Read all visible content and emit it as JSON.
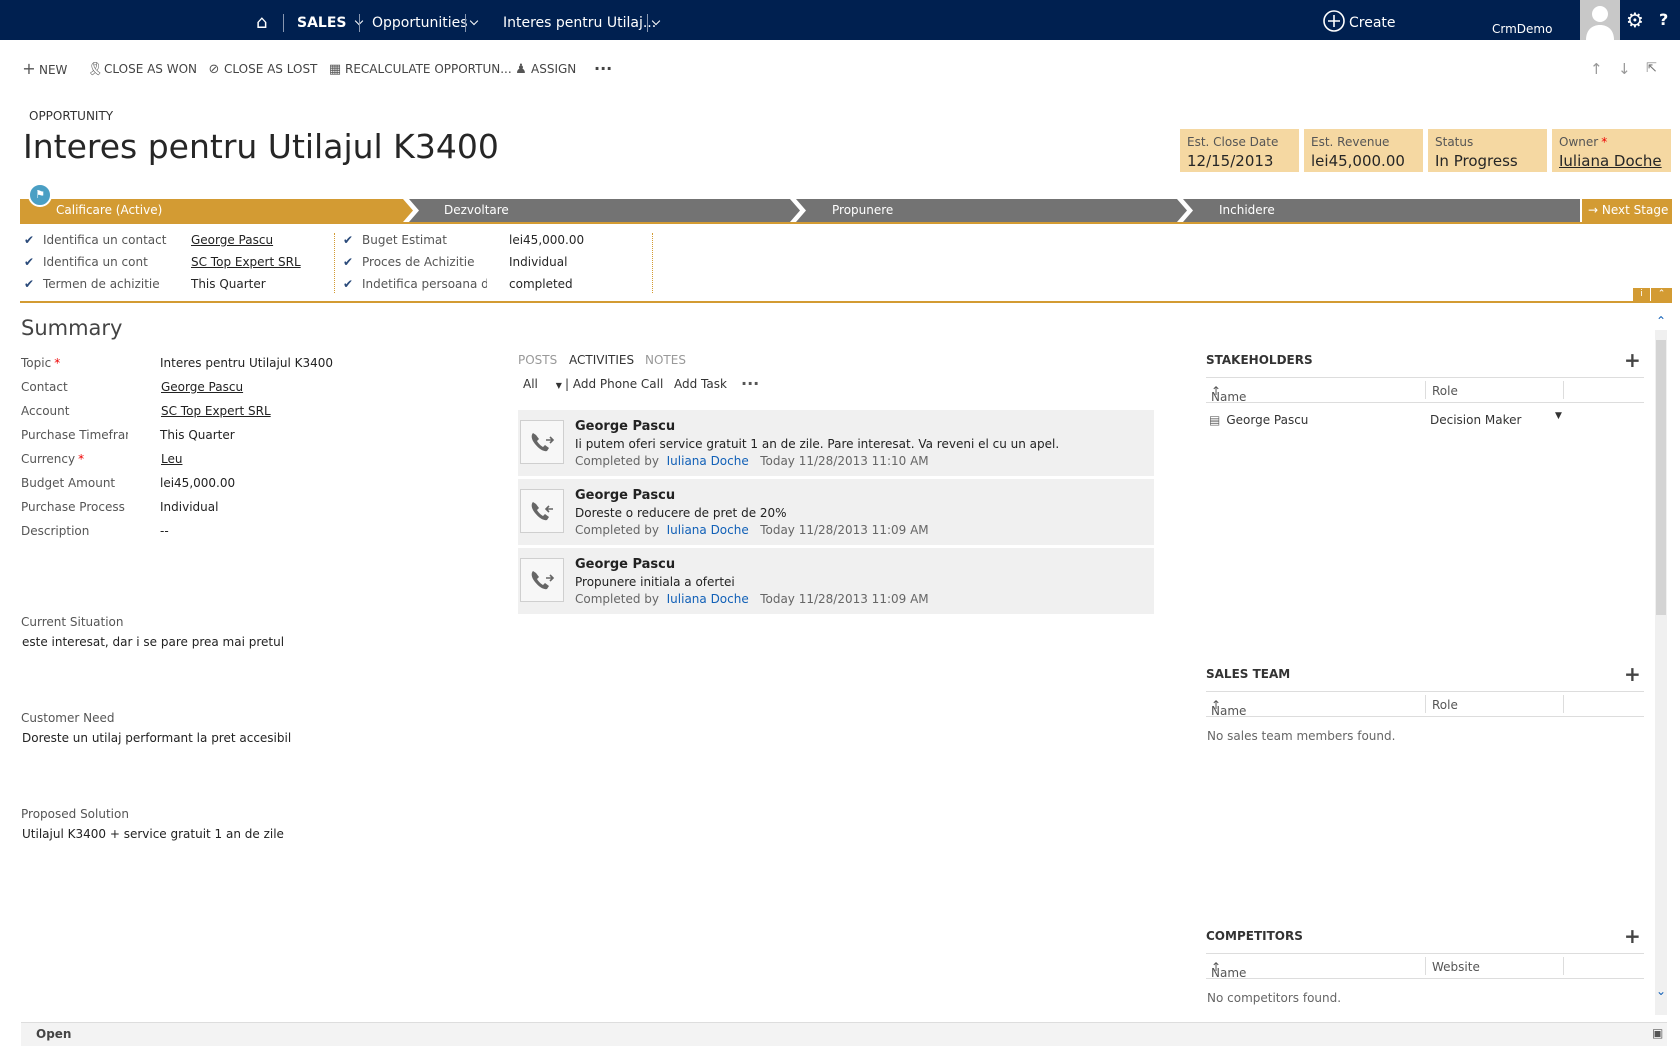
{
  "nav": {
    "area": "SALES",
    "entity": "Opportunities",
    "record": "Interes pentru Utilaj...",
    "create_label": "Create",
    "user": "CrmDemo"
  },
  "commands": {
    "new": "NEW",
    "close_won": "CLOSE AS WON",
    "close_lost": "CLOSE AS LOST",
    "recalc": "RECALCULATE OPPORTUN...",
    "assign": "ASSIGN"
  },
  "header": {
    "entity_label": "OPPORTUNITY",
    "title": "Interes pentru Utilajul K3400",
    "tiles": [
      {
        "label": "Est. Close Date",
        "value": "12/15/2013"
      },
      {
        "label": "Est. Revenue",
        "value": "lei45,000.00"
      },
      {
        "label": "Status",
        "value": "In Progress"
      },
      {
        "label": "Owner",
        "value": "Iuliana Doche"
      }
    ]
  },
  "process": {
    "stages": [
      "Calificare (Active)",
      "Dezvoltare",
      "Propunere",
      "Inchidere"
    ],
    "next_stage": "Next Stage",
    "steps_col1": [
      {
        "label": "Identifica un contact",
        "value": "George Pascu"
      },
      {
        "label": "Identifica un cont",
        "value": "SC Top Expert SRL"
      },
      {
        "label": "Termen de achizitie",
        "value": "This Quarter"
      }
    ],
    "steps_col2": [
      {
        "label": "Buget Estimat",
        "value": "lei45,000.00"
      },
      {
        "label": "Proces de Achizitie",
        "value": "Individual"
      },
      {
        "label": "Indetifica persoana de",
        "value": "completed"
      }
    ]
  },
  "summary": {
    "title": "Summary",
    "fields": [
      {
        "label": "Topic",
        "value": "Interes pentru Utilajul K3400"
      },
      {
        "label": "Contact",
        "value": "George Pascu"
      },
      {
        "label": "Account",
        "value": "SC Top Expert SRL"
      },
      {
        "label": "Purchase Timeframe",
        "value": "This Quarter"
      },
      {
        "label": "Currency",
        "value": "Leu"
      },
      {
        "label": "Budget Amount",
        "value": "lei45,000.00"
      },
      {
        "label": "Purchase Process",
        "value": "Individual"
      },
      {
        "label": "Description",
        "value": "--"
      }
    ],
    "current_situation_label": "Current Situation",
    "current_situation": "este interesat, dar i se pare prea mai pretul",
    "customer_need_label": "Customer Need",
    "customer_need": "Doreste un utilaj performant la pret accesibil",
    "proposed_solution_label": "Proposed Solution",
    "proposed_solution": "Utilajul K3400 + service gratuit 1 an de zile"
  },
  "social": {
    "tabs": [
      "POSTS",
      "ACTIVITIES",
      "NOTES"
    ],
    "filter": "All",
    "add_phone_call": "Add Phone Call",
    "add_task": "Add Task",
    "activities": [
      {
        "name": "George Pascu",
        "desc": "Ii putem oferi service gratuit 1 an de zile. Pare interesat. Va reveni el cu un apel.",
        "completed_by": "Completed by",
        "owner": "Iuliana Doche",
        "when": "Today 11/28/2013 11:10 AM"
      },
      {
        "name": "George Pascu",
        "desc": "Doreste o reducere de pret de 20%",
        "completed_by": "Completed by",
        "owner": "Iuliana Doche",
        "when": "Today 11/28/2013 11:09 AM"
      },
      {
        "name": "George Pascu",
        "desc": "Propunere initiala a ofertei",
        "completed_by": "Completed by",
        "owner": "Iuliana Doche",
        "when": "Today 11/28/2013 11:09 AM"
      }
    ]
  },
  "stakeholders": {
    "title": "STAKEHOLDERS",
    "col_name": "Name",
    "col_role": "Role",
    "rows": [
      {
        "name": "George Pascu",
        "role": "Decision Maker"
      }
    ]
  },
  "sales_team": {
    "title": "SALES TEAM",
    "col_name": "Name",
    "col_role": "Role",
    "empty": "No sales team members found."
  },
  "competitors": {
    "title": "COMPETITORS",
    "col_name": "Name",
    "col_website": "Website",
    "empty": "No competitors found."
  },
  "footer": {
    "status": "Open"
  },
  "colors": {
    "nav": "#002050",
    "stage_active": "#d39b33",
    "stage": "#737373",
    "tile": "#f5d8a2",
    "link": "#1160b7"
  }
}
